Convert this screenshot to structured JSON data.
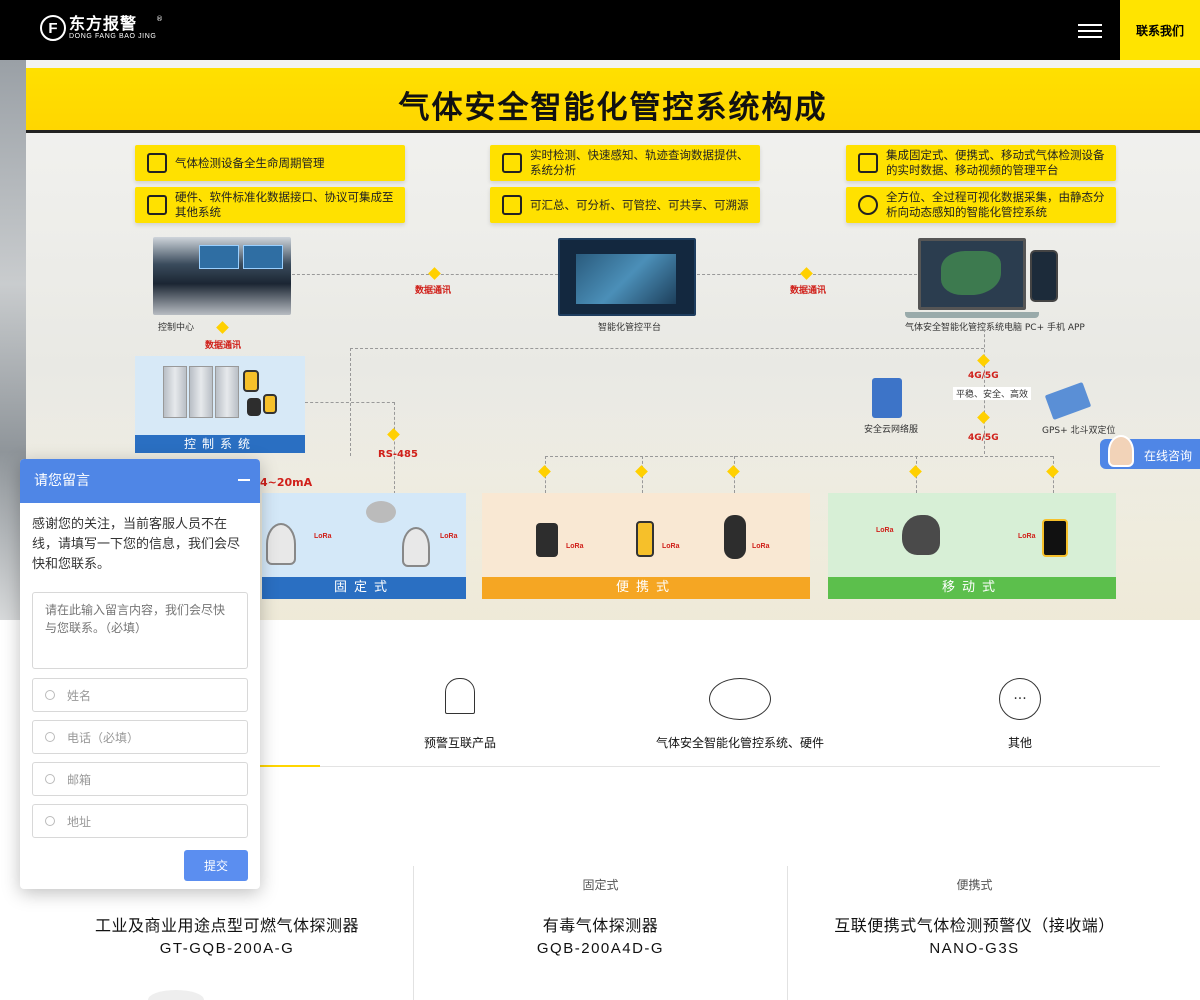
{
  "header": {
    "logo_mark": "F",
    "logo_cn": "东方报警",
    "logo_en": "DONG FANG BAO JING",
    "logo_reg": "®",
    "contact_label": "联系我们",
    "menu_icon": "hamburger-menu-icon"
  },
  "banner": {
    "title": "气体安全智能化管控系统构成",
    "features": {
      "f1": "气体检测设备全生命周期管理",
      "f2": "硬件、软件标准化数据接口、协议可集成至其他系统",
      "f3": "实时检测、快速感知、轨迹查询数据提供、系统分析",
      "f4": "可汇总、可分析、可管控、可共享、可溯源",
      "f5": "集成固定式、便携式、移动式气体检测设备的实时数据、移动视频的管理平台",
      "f6": "全方位、全过程可视化数据采集，由静态分析向动态感知的智能化管控系统"
    },
    "nodes": {
      "control_center": "控制中心",
      "platform": "智能化管控平台",
      "pc_app": "气体安全智能化管控系统电脑 PC+ 手机 APP",
      "cloud": "安全云网络服",
      "gps": "GPS+ 北斗双定位",
      "control_system": "控制系统"
    },
    "links": {
      "data_comm_1": "数据通讯",
      "data_comm_2": "数据通讯",
      "data_comm_3": "数据通讯",
      "g5_top": "4G/5G",
      "g5_bottom": "4G/5G",
      "qualities": "平稳、安全、高效",
      "rs485": "RS-485",
      "ma": "4~20mA"
    },
    "groups": {
      "fixed": "固定式",
      "portable": "便携式",
      "mobile": "移动式"
    },
    "lora": "LoRa"
  },
  "tabs": [
    {
      "label": "预警互联产品",
      "icon": "alarm-light-icon"
    },
    {
      "label": "气体安全智能化管控系统、硬件",
      "icon": "system-hardware-icon"
    },
    {
      "label": "其他",
      "icon": "more-dots-icon",
      "glyph": "···"
    }
  ],
  "products": [
    {
      "category": "",
      "name": "工业及商业用途点型可燃气体探测器",
      "model": "GT-GQB-200A-G"
    },
    {
      "category": "固定式",
      "name": "有毒气体探测器",
      "model": "GQB-200A4D-G"
    },
    {
      "category": "便携式",
      "name": "互联便携式气体检测预警仪（接收端）",
      "model": "NANO-G3S"
    }
  ],
  "chat": {
    "title": "请您留言",
    "intro": "感谢您的关注，当前客服人员不在线，请填写一下您的信息，我们会尽快和您联系。",
    "message_placeholder": "请在此输入留言内容，我们会尽快与您联系。（必填）",
    "name_placeholder": "姓名",
    "phone_placeholder": "电话（必填）",
    "email_placeholder": "邮箱",
    "address_placeholder": "地址",
    "submit_label": "提交"
  },
  "consult": {
    "label": "在线咨询"
  },
  "colors": {
    "brand_yellow": "#ffe400",
    "chat_blue": "#4f86e6",
    "fixed_blue": "#2a6fc2",
    "portable_orange": "#f5a623",
    "mobile_green": "#5cbf4c"
  }
}
